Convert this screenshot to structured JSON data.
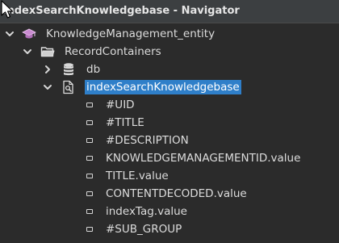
{
  "window": {
    "title": "indexSearchKnowledgebase - Navigator"
  },
  "tree": {
    "entity": {
      "label": "KnowledgeManagement_entity",
      "icon": "graduation-cap-icon",
      "expanded": true
    },
    "containers": {
      "label": "RecordContainers",
      "icon": "folder-open-icon",
      "expanded": true
    },
    "db": {
      "label": "db",
      "icon": "database-icon",
      "expanded": false
    },
    "index": {
      "label": "indexSearchKnowledgebase",
      "icon": "search-document-icon",
      "expanded": true,
      "selected": true
    },
    "fields": [
      {
        "label": "#UID"
      },
      {
        "label": "#TITLE"
      },
      {
        "label": "#DESCRIPTION"
      },
      {
        "label": "KNOWLEDGEMANAGEMENTID.value"
      },
      {
        "label": "TITLE.value"
      },
      {
        "label": "CONTENTDECODED.value"
      },
      {
        "label": "indexTag.value"
      },
      {
        "label": "#SUB_GROUP"
      }
    ]
  },
  "colors": {
    "background": "#2b2b2b",
    "titlebar": "#3c3f41",
    "selection": "#2f7fc9",
    "text": "#dcdcdc"
  }
}
